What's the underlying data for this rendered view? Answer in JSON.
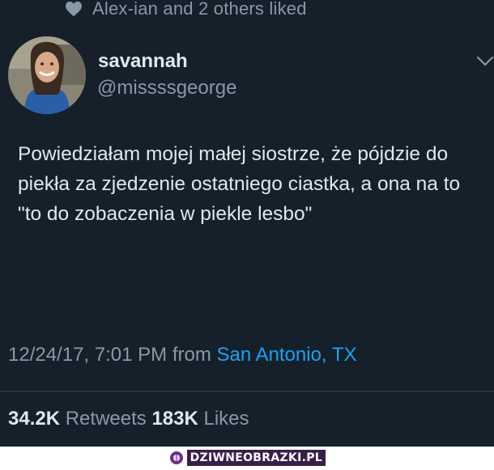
{
  "social_context": {
    "icon": "heart-icon",
    "text": "Alex-ian and 2 others liked"
  },
  "author": {
    "display_name": "savannah",
    "handle": "@missssgeorge",
    "avatar": "avatar-photo"
  },
  "tweet": {
    "text": "Powiedziałam mojej małej siostrze, że pójdzie do piekła za zjedzenie ostatniego ciastka, a ona na to \"to do zobaczenia w piekle lesbo\""
  },
  "meta": {
    "timestamp": "12/24/17, 7:01 PM",
    "from_label": "from",
    "location": "San Antonio, TX"
  },
  "stats": {
    "retweets_count": "34.2K",
    "retweets_label": "Retweets",
    "likes_count": "183K",
    "likes_label": "Likes"
  },
  "watermark": {
    "text": "DZIWNEOBRAZKI.PL"
  },
  "colors": {
    "background": "#15202b",
    "primary_text": "#e1e8ed",
    "secondary_text": "#8899a6",
    "link": "#1da1f2"
  }
}
